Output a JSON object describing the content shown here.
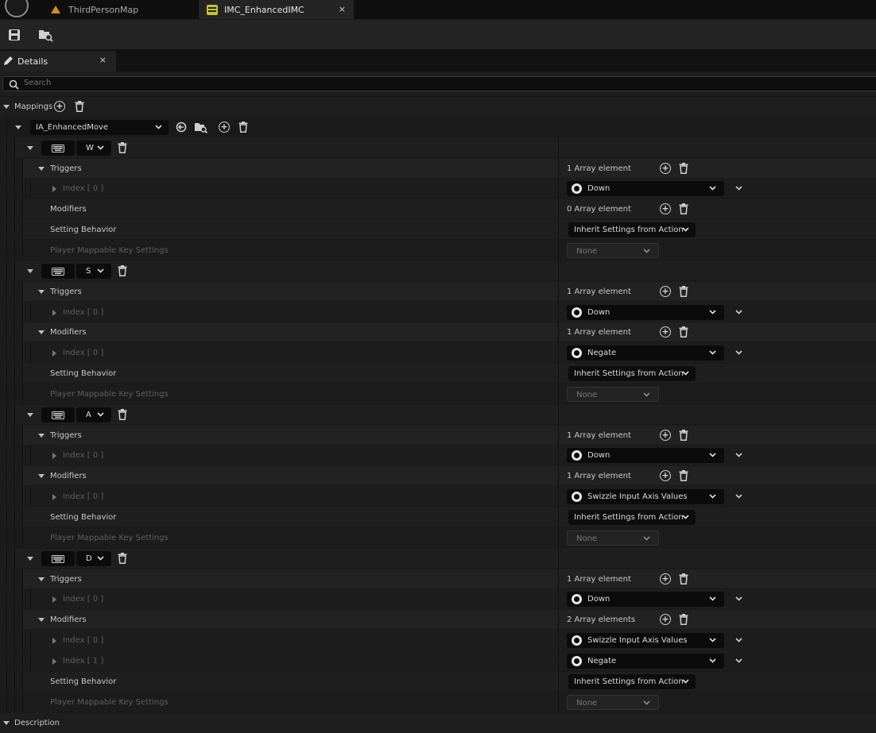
{
  "tabs": [
    {
      "label": "ThirdPersonMap",
      "active": false
    },
    {
      "label": "IMC_EnhancedIMC",
      "active": true
    }
  ],
  "toolbar": {
    "save_icon": "save-icon",
    "browse_icon": "browse-asset-icon"
  },
  "panel": {
    "title": "Details",
    "close": "×"
  },
  "search": {
    "placeholder": "Search"
  },
  "mappings": {
    "label": "Mappings",
    "action": "IA_EnhancedMove",
    "keys": [
      {
        "key": "W",
        "triggers": {
          "count": "1 Array element",
          "items": [
            {
              "index": "Index [ 0 ]",
              "value": "Down"
            }
          ]
        },
        "modifiers": {
          "count": "0 Array element",
          "items": []
        },
        "setting_label": "Setting Behavior",
        "setting_value": "Inherit Settings from Action",
        "pmk_label": "Player Mappable Key Settings",
        "pmk_value": "None"
      },
      {
        "key": "S",
        "triggers": {
          "count": "1 Array element",
          "items": [
            {
              "index": "Index [ 0 ]",
              "value": "Down"
            }
          ]
        },
        "modifiers": {
          "count": "1 Array element",
          "items": [
            {
              "index": "Index [ 0 ]",
              "value": "Negate"
            }
          ]
        },
        "setting_label": "Setting Behavior",
        "setting_value": "Inherit Settings from Action",
        "pmk_label": "Player Mappable Key Settings",
        "pmk_value": "None"
      },
      {
        "key": "A",
        "triggers": {
          "count": "1 Array element",
          "items": [
            {
              "index": "Index [ 0 ]",
              "value": "Down"
            }
          ]
        },
        "modifiers": {
          "count": "1 Array element",
          "items": [
            {
              "index": "Index [ 0 ]",
              "value": "Swizzle Input Axis Values"
            }
          ]
        },
        "setting_label": "Setting Behavior",
        "setting_value": "Inherit Settings from Action",
        "pmk_label": "Player Mappable Key Settings",
        "pmk_value": "None"
      },
      {
        "key": "D",
        "triggers": {
          "count": "1 Array element",
          "items": [
            {
              "index": "Index [ 0 ]",
              "value": "Down"
            }
          ]
        },
        "modifiers": {
          "count": "2 Array elements",
          "items": [
            {
              "index": "Index [ 0 ]",
              "value": "Swizzle Input Axis Values"
            },
            {
              "index": "Index [ 1 ]",
              "value": "Negate"
            }
          ]
        },
        "setting_label": "Setting Behavior",
        "setting_value": "Inherit Settings from Action",
        "pmk_label": "Player Mappable Key Settings",
        "pmk_value": "None"
      }
    ]
  },
  "labels": {
    "triggers": "Triggers",
    "modifiers": "Modifiers"
  },
  "description": {
    "label": "Description"
  }
}
